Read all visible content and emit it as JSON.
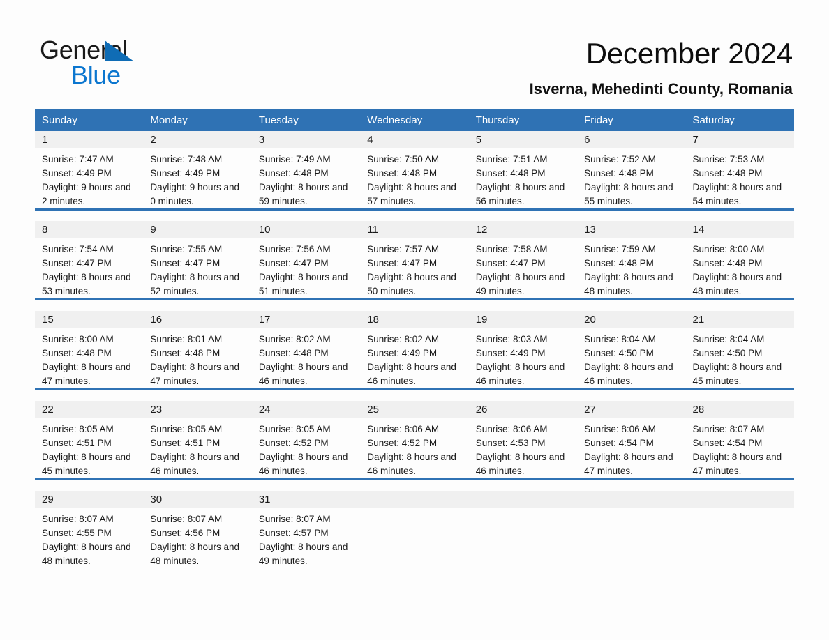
{
  "logo": {
    "word_dark": "General",
    "word_blue": "Blue",
    "triangle_color": "#0f6cb5",
    "blue_color": "#0b76cf"
  },
  "header": {
    "title": "December 2024",
    "subtitle": "Isverna, Mehedinti County, Romania"
  },
  "colors": {
    "header_blue": "#2f72b4",
    "daynum_band": "#f0f0f0",
    "page_background": "#fdfdfd",
    "text": "#1a1a1a"
  },
  "weekdays": [
    "Sunday",
    "Monday",
    "Tuesday",
    "Wednesday",
    "Thursday",
    "Friday",
    "Saturday"
  ],
  "weeks": [
    {
      "days": [
        {
          "num": "1",
          "sunrise": "Sunrise: 7:47 AM",
          "sunset": "Sunset: 4:49 PM",
          "daylight": "Daylight: 9 hours and 2 minutes."
        },
        {
          "num": "2",
          "sunrise": "Sunrise: 7:48 AM",
          "sunset": "Sunset: 4:49 PM",
          "daylight": "Daylight: 9 hours and 0 minutes."
        },
        {
          "num": "3",
          "sunrise": "Sunrise: 7:49 AM",
          "sunset": "Sunset: 4:48 PM",
          "daylight": "Daylight: 8 hours and 59 minutes."
        },
        {
          "num": "4",
          "sunrise": "Sunrise: 7:50 AM",
          "sunset": "Sunset: 4:48 PM",
          "daylight": "Daylight: 8 hours and 57 minutes."
        },
        {
          "num": "5",
          "sunrise": "Sunrise: 7:51 AM",
          "sunset": "Sunset: 4:48 PM",
          "daylight": "Daylight: 8 hours and 56 minutes."
        },
        {
          "num": "6",
          "sunrise": "Sunrise: 7:52 AM",
          "sunset": "Sunset: 4:48 PM",
          "daylight": "Daylight: 8 hours and 55 minutes."
        },
        {
          "num": "7",
          "sunrise": "Sunrise: 7:53 AM",
          "sunset": "Sunset: 4:48 PM",
          "daylight": "Daylight: 8 hours and 54 minutes."
        }
      ]
    },
    {
      "days": [
        {
          "num": "8",
          "sunrise": "Sunrise: 7:54 AM",
          "sunset": "Sunset: 4:47 PM",
          "daylight": "Daylight: 8 hours and 53 minutes."
        },
        {
          "num": "9",
          "sunrise": "Sunrise: 7:55 AM",
          "sunset": "Sunset: 4:47 PM",
          "daylight": "Daylight: 8 hours and 52 minutes."
        },
        {
          "num": "10",
          "sunrise": "Sunrise: 7:56 AM",
          "sunset": "Sunset: 4:47 PM",
          "daylight": "Daylight: 8 hours and 51 minutes."
        },
        {
          "num": "11",
          "sunrise": "Sunrise: 7:57 AM",
          "sunset": "Sunset: 4:47 PM",
          "daylight": "Daylight: 8 hours and 50 minutes."
        },
        {
          "num": "12",
          "sunrise": "Sunrise: 7:58 AM",
          "sunset": "Sunset: 4:47 PM",
          "daylight": "Daylight: 8 hours and 49 minutes."
        },
        {
          "num": "13",
          "sunrise": "Sunrise: 7:59 AM",
          "sunset": "Sunset: 4:48 PM",
          "daylight": "Daylight: 8 hours and 48 minutes."
        },
        {
          "num": "14",
          "sunrise": "Sunrise: 8:00 AM",
          "sunset": "Sunset: 4:48 PM",
          "daylight": "Daylight: 8 hours and 48 minutes."
        }
      ]
    },
    {
      "days": [
        {
          "num": "15",
          "sunrise": "Sunrise: 8:00 AM",
          "sunset": "Sunset: 4:48 PM",
          "daylight": "Daylight: 8 hours and 47 minutes."
        },
        {
          "num": "16",
          "sunrise": "Sunrise: 8:01 AM",
          "sunset": "Sunset: 4:48 PM",
          "daylight": "Daylight: 8 hours and 47 minutes."
        },
        {
          "num": "17",
          "sunrise": "Sunrise: 8:02 AM",
          "sunset": "Sunset: 4:48 PM",
          "daylight": "Daylight: 8 hours and 46 minutes."
        },
        {
          "num": "18",
          "sunrise": "Sunrise: 8:02 AM",
          "sunset": "Sunset: 4:49 PM",
          "daylight": "Daylight: 8 hours and 46 minutes."
        },
        {
          "num": "19",
          "sunrise": "Sunrise: 8:03 AM",
          "sunset": "Sunset: 4:49 PM",
          "daylight": "Daylight: 8 hours and 46 minutes."
        },
        {
          "num": "20",
          "sunrise": "Sunrise: 8:04 AM",
          "sunset": "Sunset: 4:50 PM",
          "daylight": "Daylight: 8 hours and 46 minutes."
        },
        {
          "num": "21",
          "sunrise": "Sunrise: 8:04 AM",
          "sunset": "Sunset: 4:50 PM",
          "daylight": "Daylight: 8 hours and 45 minutes."
        }
      ]
    },
    {
      "days": [
        {
          "num": "22",
          "sunrise": "Sunrise: 8:05 AM",
          "sunset": "Sunset: 4:51 PM",
          "daylight": "Daylight: 8 hours and 45 minutes."
        },
        {
          "num": "23",
          "sunrise": "Sunrise: 8:05 AM",
          "sunset": "Sunset: 4:51 PM",
          "daylight": "Daylight: 8 hours and 46 minutes."
        },
        {
          "num": "24",
          "sunrise": "Sunrise: 8:05 AM",
          "sunset": "Sunset: 4:52 PM",
          "daylight": "Daylight: 8 hours and 46 minutes."
        },
        {
          "num": "25",
          "sunrise": "Sunrise: 8:06 AM",
          "sunset": "Sunset: 4:52 PM",
          "daylight": "Daylight: 8 hours and 46 minutes."
        },
        {
          "num": "26",
          "sunrise": "Sunrise: 8:06 AM",
          "sunset": "Sunset: 4:53 PM",
          "daylight": "Daylight: 8 hours and 46 minutes."
        },
        {
          "num": "27",
          "sunrise": "Sunrise: 8:06 AM",
          "sunset": "Sunset: 4:54 PM",
          "daylight": "Daylight: 8 hours and 47 minutes."
        },
        {
          "num": "28",
          "sunrise": "Sunrise: 8:07 AM",
          "sunset": "Sunset: 4:54 PM",
          "daylight": "Daylight: 8 hours and 47 minutes."
        }
      ]
    },
    {
      "days": [
        {
          "num": "29",
          "sunrise": "Sunrise: 8:07 AM",
          "sunset": "Sunset: 4:55 PM",
          "daylight": "Daylight: 8 hours and 48 minutes."
        },
        {
          "num": "30",
          "sunrise": "Sunrise: 8:07 AM",
          "sunset": "Sunset: 4:56 PM",
          "daylight": "Daylight: 8 hours and 48 minutes."
        },
        {
          "num": "31",
          "sunrise": "Sunrise: 8:07 AM",
          "sunset": "Sunset: 4:57 PM",
          "daylight": "Daylight: 8 hours and 49 minutes."
        },
        {
          "num": "",
          "sunrise": "",
          "sunset": "",
          "daylight": ""
        },
        {
          "num": "",
          "sunrise": "",
          "sunset": "",
          "daylight": ""
        },
        {
          "num": "",
          "sunrise": "",
          "sunset": "",
          "daylight": ""
        },
        {
          "num": "",
          "sunrise": "",
          "sunset": "",
          "daylight": ""
        }
      ]
    }
  ]
}
